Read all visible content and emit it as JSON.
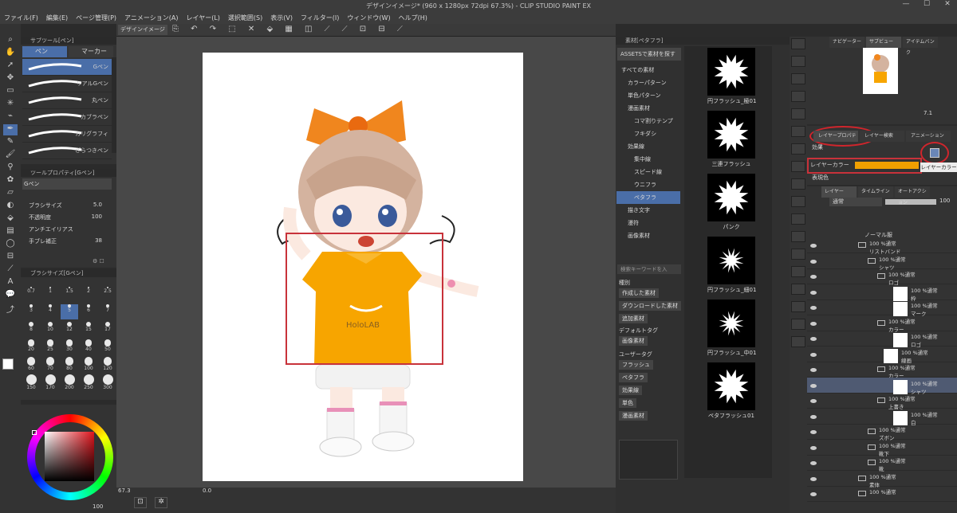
{
  "window": {
    "title": "デザインイメージ* (960 x 1280px 72dpi 67.3%) - CLIP STUDIO PAINT EX",
    "minimize": "—",
    "maximize": "☐",
    "close": "✕"
  },
  "menu": [
    "ファイル(F)",
    "編集(E)",
    "ページ管理(P)",
    "アニメーション(A)",
    "レイヤー(L)",
    "選択範囲(S)",
    "表示(V)",
    "フィルター(I)",
    "ウィンドウ(W)",
    "ヘルプ(H)"
  ],
  "canvas_tab": {
    "label": "デザインイメージ"
  },
  "subtool": {
    "header": "サブツール[ペン]",
    "tabs": [
      "ペン",
      "マーカー"
    ],
    "brushes": [
      "Gペン",
      "リアルGペン",
      "丸ペン",
      "カブラペン",
      "カリグラフィ",
      "ざらつきペン"
    ]
  },
  "toolprop": {
    "header": "ツールプロパティ[Gペン]",
    "brush": "Gペン",
    "rows": [
      {
        "label": "ブラシサイズ",
        "value": "5.0"
      },
      {
        "label": "不透明度",
        "value": "100"
      },
      {
        "label": "アンチエイリアス",
        "value": ""
      },
      {
        "label": "手ブレ補正",
        "value": "38"
      }
    ]
  },
  "brushsize": {
    "header": "ブラシサイズ[Gペン]",
    "sizes": [
      "0.7",
      "1",
      "1.5",
      "2",
      "2.5",
      "3",
      "4",
      "5",
      "6",
      "7",
      "8",
      "10",
      "12",
      "15",
      "17",
      "20",
      "25",
      "30",
      "40",
      "50",
      "60",
      "70",
      "80",
      "100",
      "120",
      "150",
      "170",
      "200",
      "250",
      "300"
    ],
    "selected": "5"
  },
  "color_footer": {
    "value": "100"
  },
  "status": {
    "zoom": "67.3",
    "angle": "0.0"
  },
  "material": {
    "header": "素材[ペタフラ]",
    "assets_button": "ASSETSで素材を探す",
    "tree": [
      "すべての素材",
      "カラーパターン",
      "単色パターン",
      "漫画素材",
      "コマ割りテンプ",
      "フキダシ",
      "効果線",
      "集中線",
      "スピード線",
      "ウニフラ",
      "ペタフラ",
      "描き文字",
      "漫符",
      "画像素材"
    ],
    "search_placeholder": "検索キーワードを入",
    "category_label": "種別",
    "categories": [
      "作成した素材",
      "ダウンロードした素材",
      "追加素材"
    ],
    "default_tag_label": "デフォルトタグ",
    "default_tags": [
      "画像素材"
    ],
    "user_tag_label": "ユーザータグ",
    "user_tags": [
      "フラッシュ",
      "ペタフラ",
      "効果線",
      "単色",
      "漫画素材"
    ],
    "items": [
      "円フラッシュ_極01",
      "三連フラッシュ",
      "パンク",
      "円フラッシュ_細01",
      "円フラッシュ_中01",
      "ペタフラッシュ01"
    ]
  },
  "right": {
    "nav_tabs": [
      "ナビゲーター",
      "サブビュー",
      "アイテムバンク"
    ],
    "nav_value": "7.1",
    "prop_tabs": [
      "レイヤープロパティ",
      "レイヤー検索",
      "アニメーション"
    ],
    "effect_label": "効果",
    "layer_color_label": "レイヤーカラー",
    "layer_color_tooltip": "レイヤーカラー",
    "expression_label": "表現色",
    "layer_tabs": [
      "レイヤー",
      "タイムライン",
      "オートアクション"
    ],
    "blend_mode": "通常",
    "opacity": "100",
    "layers": [
      {
        "mode": "100 %通常",
        "name": "リストバンド"
      },
      {
        "mode": "100 %通常",
        "name": "シャツ"
      },
      {
        "mode": "100 %通常",
        "name": "ロゴ"
      },
      {
        "mode": "100 %通常",
        "name": "枠"
      },
      {
        "mode": "100 %通常",
        "name": "マーク"
      },
      {
        "mode": "100 %通常",
        "name": "カラー"
      },
      {
        "mode": "100 %通常",
        "name": "ロゴ"
      },
      {
        "mode": "100 %通常",
        "name": "線画"
      },
      {
        "mode": "100 %通常",
        "name": "カラー"
      },
      {
        "mode": "100 %通常",
        "name": "シャツ"
      },
      {
        "mode": "100 %通常",
        "name": "上書き"
      },
      {
        "mode": "100 %通常",
        "name": "白"
      },
      {
        "mode": "100 %通常",
        "name": "ズボン"
      },
      {
        "mode": "100 %通常",
        "name": "靴下"
      },
      {
        "mode": "100 %通常",
        "name": "靴"
      },
      {
        "mode": "100 %通常",
        "name": "素体"
      },
      {
        "mode": "100 %通常",
        "name": ""
      }
    ],
    "top_folder": "ノーマル服"
  },
  "artwork": {
    "shirt_text": "HoloLAB"
  },
  "colors": {
    "accent": "#4a6ea8",
    "highlight": "#c8323a",
    "layer_color": "#f0a000",
    "shirt": "#f7a500"
  }
}
